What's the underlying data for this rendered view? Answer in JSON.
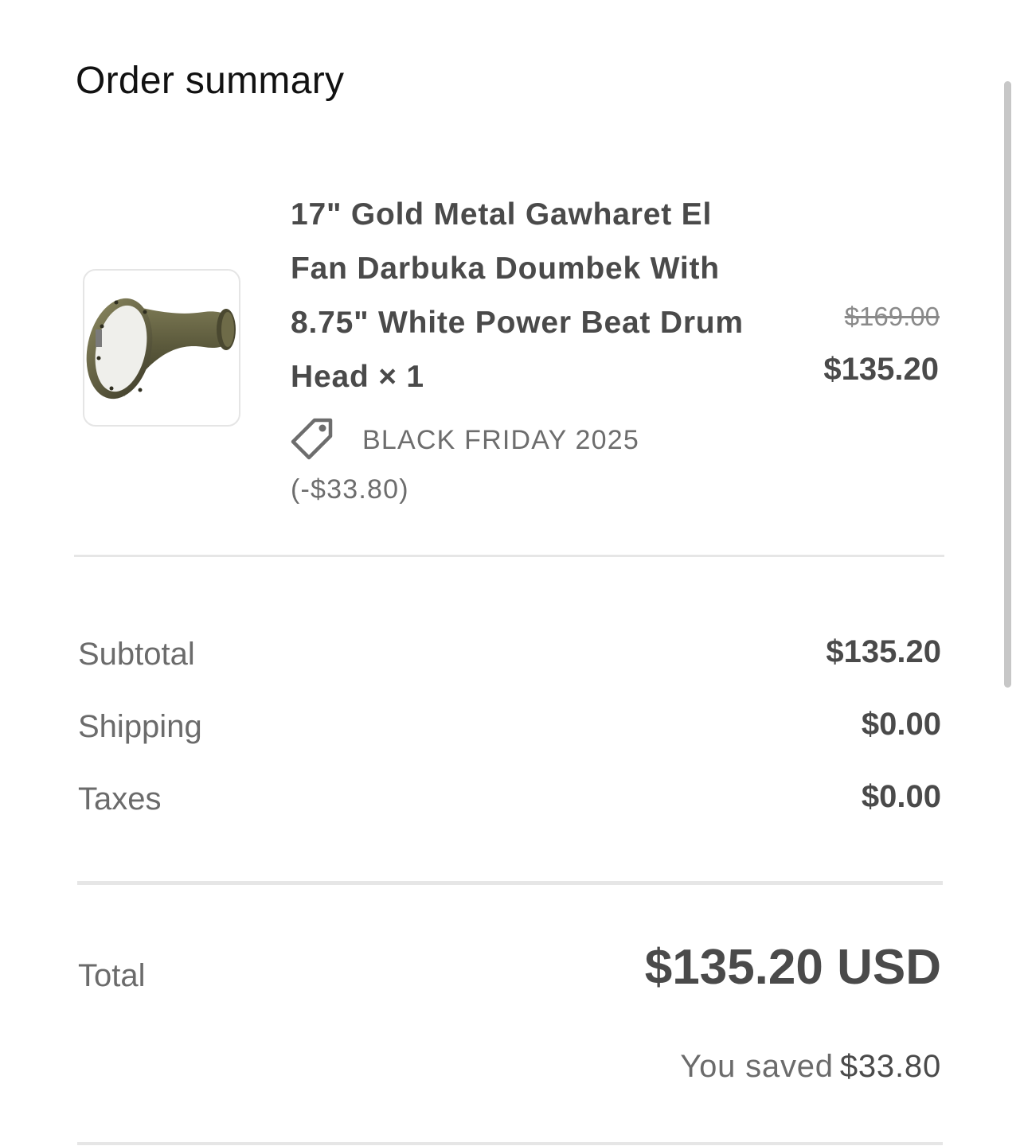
{
  "header": {
    "title": "Order summary"
  },
  "line_item": {
    "image_alt": "17\" Gold Metal Gawharet El Fan Darbuka Doumbek",
    "title": "17\" Gold Metal Gawharet El Fan Darbuka Doumbek With 8.75\" White Power Beat Drum Head × 1",
    "original_price": "$169.00",
    "price": "$135.20",
    "discount_icon": "tag-icon",
    "discount_text": "BLACK FRIDAY 2025 (-$33.80)"
  },
  "costs": {
    "subtotal_label": "Subtotal",
    "subtotal_value": "$135.20",
    "shipping_label": "Shipping",
    "shipping_value": "$0.00",
    "taxes_label": "Taxes",
    "taxes_value": "$0.00"
  },
  "total": {
    "label": "Total",
    "value": "$135.20 USD",
    "saved_label": "You saved",
    "saved_value": "$33.80"
  }
}
